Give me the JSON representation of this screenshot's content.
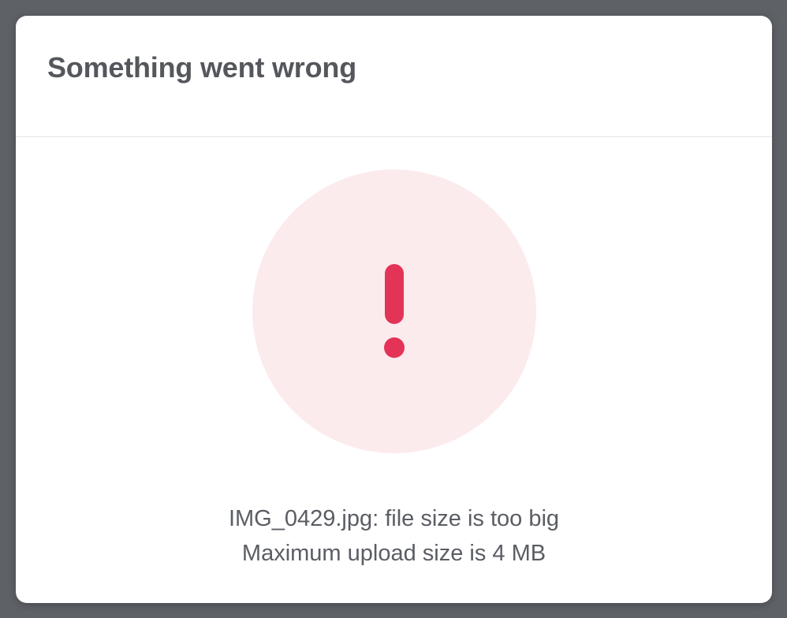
{
  "modal": {
    "title": "Something went wrong",
    "icon": "exclamation-icon",
    "error_line": "IMG_0429.jpg: file size is too big",
    "limit_line": "Maximum upload size is 4 MB"
  },
  "colors": {
    "backdrop": "#5e6267",
    "modal_bg": "#ffffff",
    "title_text": "#54575c",
    "alert_circle": "#fcebed",
    "alert_accent": "#e33458",
    "message_text": "#5a5d63"
  }
}
